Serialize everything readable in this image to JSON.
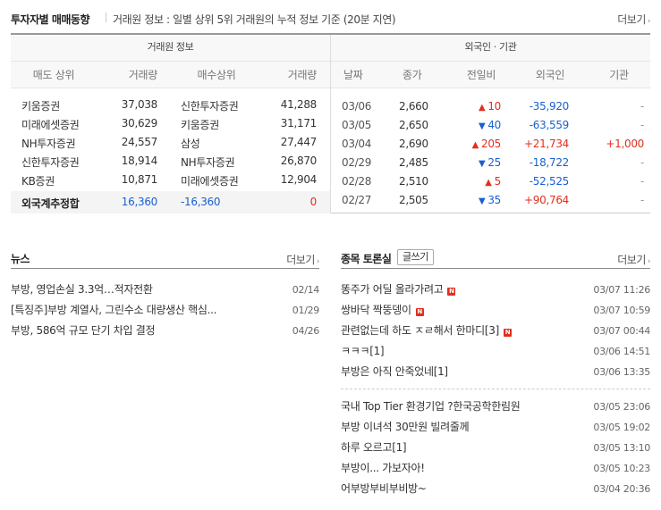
{
  "investor_trading": {
    "title": "투자자별 매매동향",
    "description": "거래원 정보 : 일별 상위 5위 거래원의 누적 정보 기준 (20분 지연)",
    "more_label": "더보기",
    "broker_group_label": "거래원 정보",
    "foreign_group_label": "외국인 · 기관",
    "broker_columns": [
      "매도 상위",
      "거래량",
      "매수상위",
      "거래량"
    ],
    "foreign_columns": [
      "날짜",
      "종가",
      "전일비",
      "외국인",
      "기관"
    ],
    "broker_rows": [
      {
        "sell": "키움증권",
        "sell_vol": "37,038",
        "buy": "신한투자증권",
        "buy_vol": "41,288"
      },
      {
        "sell": "미래에셋증권",
        "sell_vol": "30,629",
        "buy": "키움증권",
        "buy_vol": "31,171"
      },
      {
        "sell": "NH투자증권",
        "sell_vol": "24,557",
        "buy": "삼성",
        "buy_vol": "27,447"
      },
      {
        "sell": "신한투자증권",
        "sell_vol": "18,914",
        "buy": "NH투자증권",
        "buy_vol": "26,870"
      },
      {
        "sell": "KB증권",
        "sell_vol": "10,871",
        "buy": "미래에셋증권",
        "buy_vol": "12,904"
      }
    ],
    "foreign_total": {
      "label": "외국계추정합",
      "sell_vol": "16,360",
      "buy_vol": "-16,360",
      "net": "0"
    },
    "foreign_rows": [
      {
        "date": "03/06",
        "close": "2,660",
        "dir": "up",
        "change": "10",
        "foreign": "-35,920",
        "inst": "-"
      },
      {
        "date": "03/05",
        "close": "2,650",
        "dir": "down",
        "change": "40",
        "foreign": "-63,559",
        "inst": "-"
      },
      {
        "date": "03/04",
        "close": "2,690",
        "dir": "up",
        "change": "205",
        "foreign": "+21,734",
        "inst": "+1,000"
      },
      {
        "date": "02/29",
        "close": "2,485",
        "dir": "down",
        "change": "25",
        "foreign": "-18,722",
        "inst": "-"
      },
      {
        "date": "02/28",
        "close": "2,510",
        "dir": "up",
        "change": "5",
        "foreign": "-52,525",
        "inst": "-"
      },
      {
        "date": "02/27",
        "close": "2,505",
        "dir": "down",
        "change": "35",
        "foreign": "+90,764",
        "inst": "-"
      }
    ]
  },
  "news": {
    "title": "뉴스",
    "more_label": "더보기",
    "items": [
      {
        "title": "부방, 영업손실 3.3억…적자전환",
        "date": "02/14"
      },
      {
        "title": "[특징주]부방 계열사, 그린수소 대량생산 핵심...",
        "date": "01/29"
      },
      {
        "title": "부방, 586억 규모 단기 차입 결정",
        "date": "04/26"
      }
    ]
  },
  "board": {
    "title": "종목 토론실",
    "write_label": "글쓰기",
    "more_label": "더보기",
    "new_badge": "N",
    "items": [
      {
        "title": "똥주가 어딜 올라가려고",
        "new": true,
        "date": "03/07 11:26"
      },
      {
        "title": "쌍바닥 짝뚱뎅이",
        "new": true,
        "date": "03/07 10:59"
      },
      {
        "title": "관련없는데 하도 ㅈㄹ해서 한마디[3]",
        "new": true,
        "date": "03/07 00:44"
      },
      {
        "title": "ㅋㅋㅋ[1]",
        "new": false,
        "date": "03/06 14:51"
      },
      {
        "title": "부방은 아직 안죽었네[1]",
        "new": false,
        "date": "03/06 13:35"
      },
      {
        "title": "국내 Top Tier 환경기업 ?한국공학한림원",
        "new": false,
        "date": "03/05 23:06"
      },
      {
        "title": "부방 이녀석 30만원 빌려줄께",
        "new": false,
        "date": "03/05 19:02"
      },
      {
        "title": "하루 오르고[1]",
        "new": false,
        "date": "03/05 13:10"
      },
      {
        "title": "부방이... 가보자아!",
        "new": false,
        "date": "03/05 10:23"
      },
      {
        "title": "어부방부비부비방~",
        "new": false,
        "date": "03/04 20:36"
      }
    ]
  },
  "colors": {
    "up": "#e0301e",
    "down": "#1a5fd1"
  },
  "icons": {
    "up": "triangle-up-icon",
    "down": "triangle-down-icon",
    "chevron": "chevron-right-icon"
  }
}
